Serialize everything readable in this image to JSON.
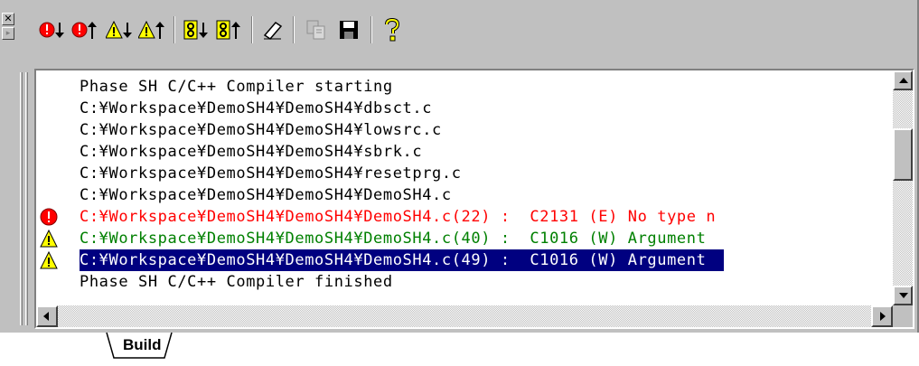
{
  "toolbar": {
    "buttons": [
      {
        "name": "next-error",
        "icon": "error-down-icon"
      },
      {
        "name": "previous-error",
        "icon": "error-up-icon"
      },
      {
        "name": "next-warning",
        "icon": "warning-down-icon"
      },
      {
        "name": "previous-warning",
        "icon": "warning-up-icon"
      },
      {
        "name": "next-tagged",
        "icon": "tag-down-icon"
      },
      {
        "name": "previous-tagged",
        "icon": "tag-up-icon"
      },
      {
        "name": "clear-window",
        "icon": "eraser-icon"
      },
      {
        "name": "copy",
        "icon": "copy-icon",
        "disabled": true
      },
      {
        "name": "save",
        "icon": "floppy-icon"
      },
      {
        "name": "help",
        "icon": "help-icon"
      }
    ]
  },
  "colors": {
    "error_text": "#ff0000",
    "warning_text": "#008000",
    "selection_bg": "#000080",
    "panel_bg": "#c0c0c0"
  },
  "output": {
    "lines": [
      {
        "text": "Phase SH C/C++ Compiler starting",
        "type": "info"
      },
      {
        "text": "C:¥Workspace¥DemoSH4¥DemoSH4¥dbsct.c",
        "type": "info"
      },
      {
        "text": "C:¥Workspace¥DemoSH4¥DemoSH4¥lowsrc.c",
        "type": "info"
      },
      {
        "text": "C:¥Workspace¥DemoSH4¥DemoSH4¥sbrk.c",
        "type": "info"
      },
      {
        "text": "C:¥Workspace¥DemoSH4¥DemoSH4¥resetprg.c",
        "type": "info"
      },
      {
        "text": "C:¥Workspace¥DemoSH4¥DemoSH4¥DemoSH4.c",
        "type": "info"
      },
      {
        "text": "C:¥Workspace¥DemoSH4¥DemoSH4¥DemoSH4.c(22) :  C2131 (E) No type n",
        "type": "error"
      },
      {
        "text": "C:¥Workspace¥DemoSH4¥DemoSH4¥DemoSH4.c(40) :  C1016 (W) Argument",
        "type": "warning"
      },
      {
        "text": "C:¥Workspace¥DemoSH4¥DemoSH4¥DemoSH4.c(49) :  C1016 (W) Argument",
        "type": "warning",
        "selected": true
      },
      {
        "text": "Phase SH C/C++ Compiler finished",
        "type": "info"
      }
    ]
  },
  "tabs": [
    {
      "label": "Build",
      "active": true
    }
  ]
}
